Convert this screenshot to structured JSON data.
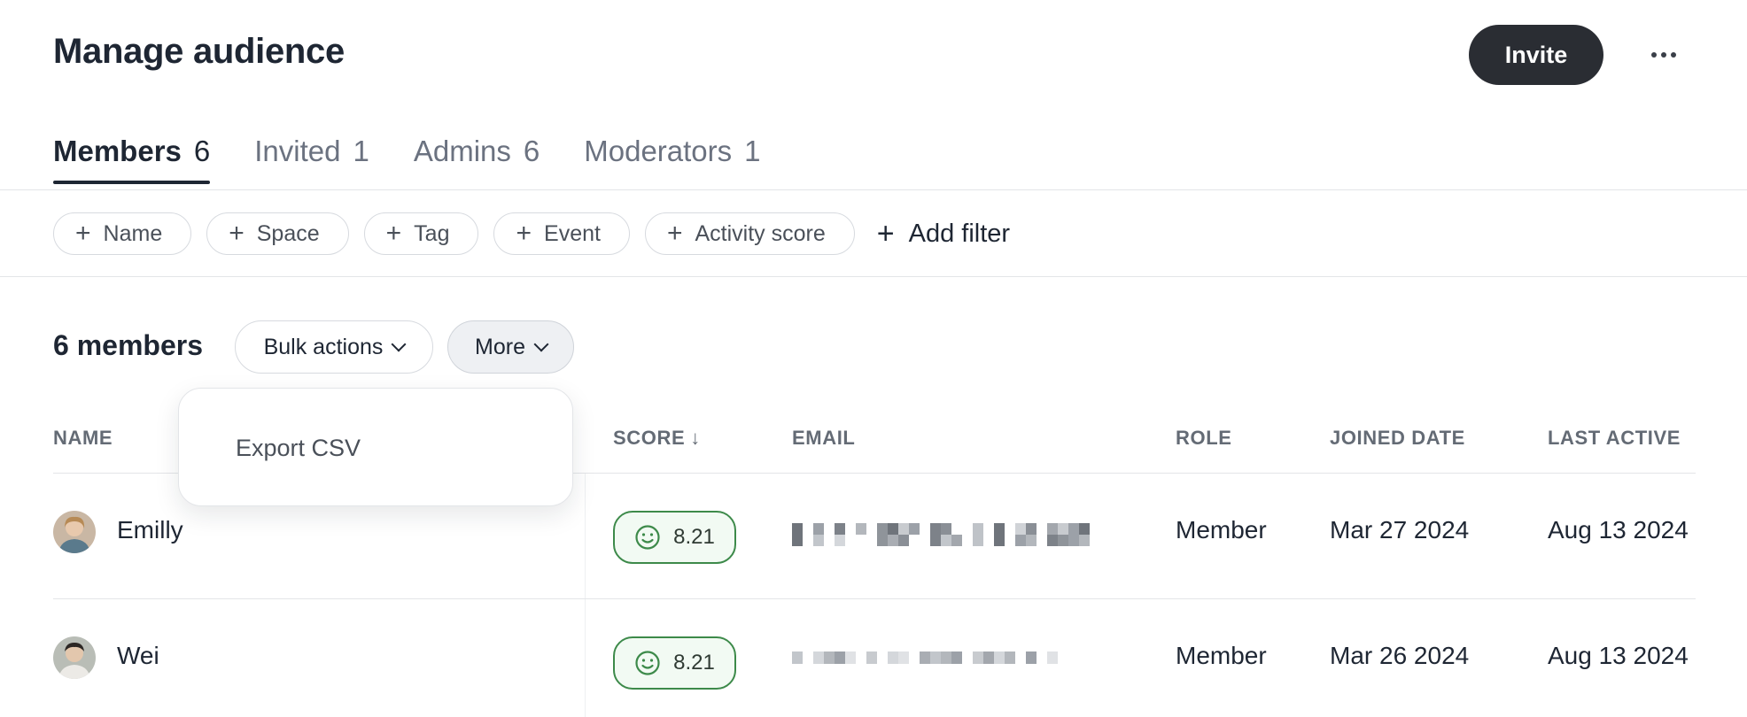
{
  "header": {
    "title": "Manage audience",
    "invite_label": "Invite",
    "more_icon": "ellipsis-icon"
  },
  "tabs": [
    {
      "label": "Members",
      "count": "6",
      "active": true
    },
    {
      "label": "Invited",
      "count": "1",
      "active": false
    },
    {
      "label": "Admins",
      "count": "6",
      "active": false
    },
    {
      "label": "Moderators",
      "count": "1",
      "active": false
    }
  ],
  "filters": {
    "chips": [
      "Name",
      "Space",
      "Tag",
      "Event",
      "Activity score"
    ],
    "add_filter_label": "Add filter"
  },
  "toolbar": {
    "member_count": "6 members",
    "bulk_actions_label": "Bulk actions",
    "more_label": "More"
  },
  "more_menu": {
    "items": [
      "Export CSV"
    ]
  },
  "table": {
    "columns": {
      "name": "NAME",
      "score": "SCORE",
      "email": "EMAIL",
      "role": "ROLE",
      "joined": "JOINED DATE",
      "last_active": "LAST ACTIVE"
    },
    "sort_icon": "arrow-down-icon",
    "rows": [
      {
        "name": "Emilly",
        "score": "8.21",
        "role": "Member",
        "joined": "Mar 27 2024",
        "last_active": "Aug 13 2024"
      },
      {
        "name": "Wei",
        "score": "8.21",
        "role": "Member",
        "joined": "Mar 26 2024",
        "last_active": "Aug 13 2024"
      }
    ]
  },
  "colors": {
    "primary_button": "#2a2d33",
    "score_border": "#3d8a4a",
    "text": "#1e2633",
    "muted": "#6b7280"
  }
}
